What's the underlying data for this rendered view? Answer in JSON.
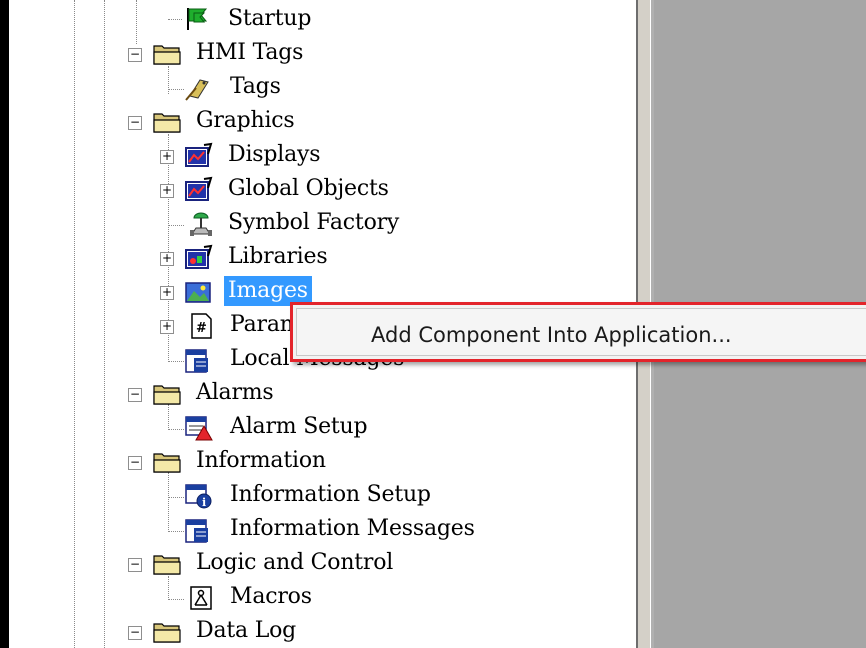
{
  "tree": [
    {
      "label": "Startup",
      "icon": "startup-flag-icon",
      "expander": null
    },
    {
      "label": "HMI Tags",
      "icon": "folder-open-icon",
      "expander": "−"
    },
    {
      "label": "Tags",
      "icon": "tags-icon",
      "expander": null
    },
    {
      "label": "Graphics",
      "icon": "folder-open-icon",
      "expander": "−"
    },
    {
      "label": "Displays",
      "icon": "displays-icon",
      "expander": "+"
    },
    {
      "label": "Global Objects",
      "icon": "global-objects-icon",
      "expander": "+"
    },
    {
      "label": "Symbol Factory",
      "icon": "symbol-factory-icon",
      "expander": null
    },
    {
      "label": "Libraries",
      "icon": "libraries-icon",
      "expander": "+"
    },
    {
      "label": "Images",
      "icon": "images-icon",
      "expander": "+",
      "selected": true
    },
    {
      "label": "Param",
      "icon": "parameters-icon",
      "expander": "+"
    },
    {
      "label": "Local Messages",
      "icon": "local-messages-icon",
      "expander": null
    },
    {
      "label": "Alarms",
      "icon": "folder-open-icon",
      "expander": "−"
    },
    {
      "label": "Alarm Setup",
      "icon": "alarm-setup-icon",
      "expander": null
    },
    {
      "label": "Information",
      "icon": "folder-open-icon",
      "expander": "−"
    },
    {
      "label": "Information Setup",
      "icon": "information-setup-icon",
      "expander": null
    },
    {
      "label": "Information Messages",
      "icon": "information-messages-icon",
      "expander": null
    },
    {
      "label": "Logic and Control",
      "icon": "folder-open-icon",
      "expander": "−"
    },
    {
      "label": "Macros",
      "icon": "macros-icon",
      "expander": null
    },
    {
      "label": "Data Log",
      "icon": "folder-open-icon",
      "expander": "−"
    }
  ],
  "context_menu": {
    "item_label": "Add Component Into Application...",
    "highlight_color": "#e3242b"
  }
}
